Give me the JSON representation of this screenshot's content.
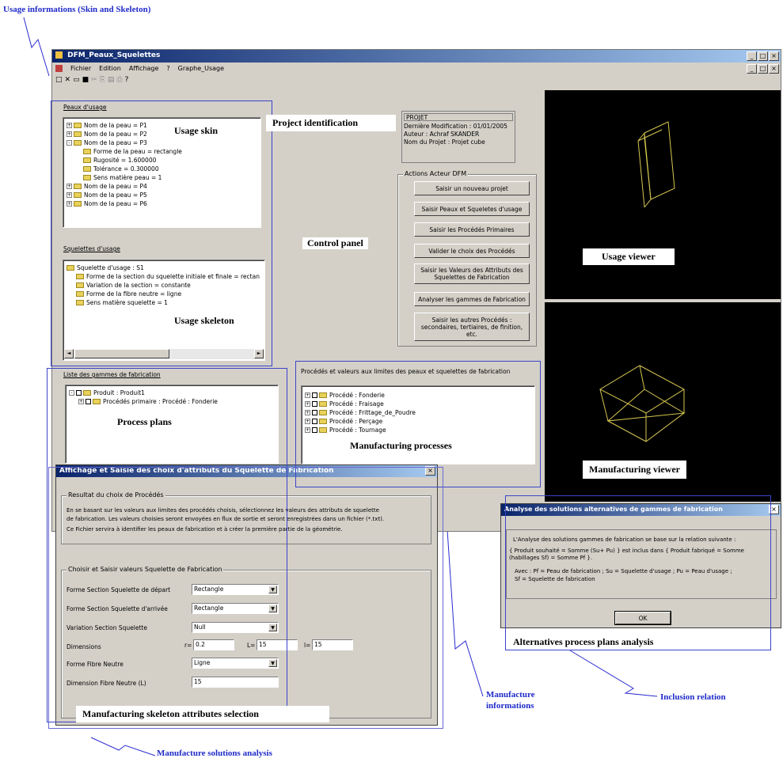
{
  "annotations": {
    "usage_info": "Usage informations (Skin and Skeleton)",
    "usage_skin": "Usage skin",
    "project_identification": "Project identification",
    "control_panel": "Control panel",
    "usage_viewer": "Usage viewer",
    "usage_skeleton": "Usage skeleton",
    "process_plans": "Process plans",
    "manufacturing_processes": "Manufacturing processes",
    "manufacturing_viewer": "Manufacturing viewer",
    "alternatives": "Alternatives process plans analysis",
    "manufacture_informations_1": "Manufacture",
    "manufacture_informations_2": "informations",
    "inclusion_relation": "Inclusion relation",
    "skeleton_attributes": "Manufacturing skeleton attributes selection",
    "solutions_analysis": "Manufacture solutions analysis"
  },
  "main_window": {
    "title": "DFM_Peaux_Squelettes",
    "menu": [
      "Fichier",
      "Edition",
      "Affichage",
      "?",
      "Graphe_Usage"
    ],
    "win_controls": [
      "_",
      "□",
      "×"
    ],
    "child_controls": [
      "_",
      "□",
      "×"
    ]
  },
  "skins": {
    "label": "Peaux d'usage",
    "items": [
      {
        "text": "Nom de la peau = P1",
        "level": 0,
        "exp": "+"
      },
      {
        "text": "Nom de la peau = P2",
        "level": 0,
        "exp": "+"
      },
      {
        "text": "Nom de la peau = P3",
        "level": 0,
        "exp": "-"
      },
      {
        "text": "Forme de la peau = rectangle",
        "level": 1,
        "exp": ""
      },
      {
        "text": "Rugosité = 1.600000",
        "level": 1,
        "exp": ""
      },
      {
        "text": "Tolérance = 0.300000",
        "level": 1,
        "exp": ""
      },
      {
        "text": "Sens matière peau = 1",
        "level": 1,
        "exp": ""
      },
      {
        "text": "Nom de la peau = P4",
        "level": 0,
        "exp": "+"
      },
      {
        "text": "Nom de la peau = P5",
        "level": 0,
        "exp": "+"
      },
      {
        "text": "Nom de la peau = P6",
        "level": 0,
        "exp": "+"
      }
    ]
  },
  "skeletons": {
    "label": "Squelettes d'usage",
    "items": [
      {
        "text": "Squelette d'usage : S1",
        "level": 0
      },
      {
        "text": "Forme de la section du squelette initiale et finale = rectan",
        "level": 1
      },
      {
        "text": "Variation de la section = constante",
        "level": 1
      },
      {
        "text": "Forme de la fibre neutre = ligne",
        "level": 1
      },
      {
        "text": "Sens matière squelette = 1",
        "level": 1
      }
    ],
    "scroll_left": "◄",
    "scroll_right": "►"
  },
  "project": {
    "heading": "PROJET",
    "last_modified": "Dernière Modification : 01/01/2005",
    "author": "Auteur : Achraf SKANDER",
    "project_name": "Nom du Projet : Projet cube"
  },
  "actions": {
    "label": "Actions Acteur DFM",
    "buttons": [
      "Saisir un nouveau projet",
      "Saisir Peaux et Squeletes d'usage",
      "Saisir les Procédés Primaires",
      "Valider le choix des Procédés",
      "Saisir les Valeurs des Attributs des Squelettes de Fabrication",
      "Analyser les gammes de Fabrication",
      "Saisir les autres Procédés : secondaires, tertiaires, de finition, etc."
    ]
  },
  "process_plans": {
    "label": "Liste des gammes de fabrication",
    "items": [
      {
        "text": "Produit : Produit1",
        "level": 0,
        "exp": "-"
      },
      {
        "text": "Procédés primaire : Procédé : Fonderie",
        "level": 1,
        "exp": "+"
      }
    ]
  },
  "procedes": {
    "label": "Procédés et valeurs aux limites des peaux et squelettes de fabrication",
    "items": [
      "Procédé : Fonderie",
      "Procédé : Fraisage",
      "Procédé : Frittage_de_Poudre",
      "Procédé : Perçage",
      "Procédé : Tournage"
    ]
  },
  "dialog_skeleton": {
    "title": "Affichage et Saisie des choix d'attributs du Squelette de Fabrication",
    "close": "×",
    "result_label": "Resultat du choix de Procédés",
    "result_text_1": "En se basant sur les valeurs aux limites des procédés choisis, sélectionnez les valeurs des attributs de squelette",
    "result_text_2": "de fabrication. Les valeurs choisies seront envoyées en flux de sortie et seront enregistrées dans un fichier (*.txt).",
    "result_text_3": "Ce Fichier servira à identifier les peaux de fabrication et à créer la première partie de la géométrie.",
    "form_label": "Choisir et Saisir valeurs Squelette de Fabrication",
    "rows": [
      {
        "label": "Forme Section Squelette de départ",
        "value": "Rectangle"
      },
      {
        "label": "Forme Section Squelette d'arrivée",
        "value": "Rectangle"
      },
      {
        "label": "Variation Section Squelette",
        "value": "Null"
      }
    ],
    "dimensions_label": "Dimensions",
    "dim_r_label": "r=",
    "dim_r": "0.2",
    "dim_L_label": "L=",
    "dim_L": "15",
    "dim_l_label": "l=",
    "dim_l": "15",
    "fibre_label": "Forme Fibre Neutre",
    "fibre_value": "Ligne",
    "fibre_dim_label": "Dimension Fibre Neutre (L)",
    "fibre_dim_value": "15",
    "arrow": "▼"
  },
  "dialog_analysis": {
    "title": "Analyse des solutions alternatives de gammes de fabrication",
    "close": "×",
    "line1": "L'Analyse des solutions gammes de fabrication se base sur la relation suivante :",
    "line2": "{ Produit souhaité = Somme (Su+ Pu) } est inclus dans { Produit fabriqué = Somme",
    "line3": "(habillages Sf) = Somme Pf }.",
    "line4": "Avec : Pf = Peau de fabrication ; Su = Squelette d'usage ; Pu = Peau d'usage ;",
    "line5": "Sf = Squelette de fabrication",
    "ok": "OK"
  }
}
